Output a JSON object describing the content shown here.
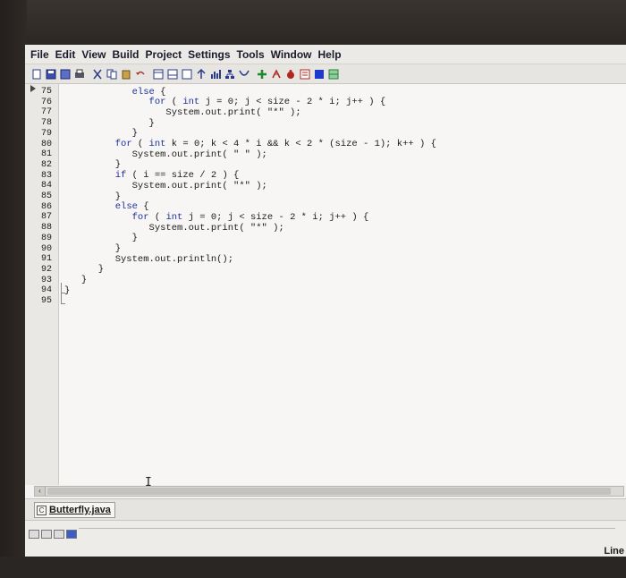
{
  "menu": [
    "File",
    "Edit",
    "View",
    "Build",
    "Project",
    "Settings",
    "Tools",
    "Window",
    "Help"
  ],
  "toolbar_icons": [
    "new-file-icon",
    "save-icon",
    "save-all-icon",
    "print-icon",
    "cut-icon",
    "copy-icon",
    "paste-icon",
    "undo-icon",
    "new-class-icon",
    "new-method-icon",
    "new-field-icon",
    "compile-icon",
    "statistics-icon",
    "uml-icon",
    "run-icon",
    "add-icon",
    "debug-icon",
    "bug-icon",
    "dictionary-icon",
    "stop-icon",
    "layout-icon"
  ],
  "editor": {
    "lines": [
      {
        "num": "75",
        "text": "            else {"
      },
      {
        "num": "76",
        "text": "               for ( int j = 0; j < size - 2 * i; j++ ) {"
      },
      {
        "num": "77",
        "text": "                  System.out.print( \"*\" );"
      },
      {
        "num": "78",
        "text": "               }"
      },
      {
        "num": "79",
        "text": "            }"
      },
      {
        "num": "80",
        "text": "         for ( int k = 0; k < 4 * i && k < 2 * (size - 1); k++ ) {"
      },
      {
        "num": "81",
        "text": "            System.out.print( \" \" );"
      },
      {
        "num": "82",
        "text": "         }"
      },
      {
        "num": "83",
        "text": "         if ( i == size / 2 ) {"
      },
      {
        "num": "84",
        "text": "            System.out.print( \"*\" );"
      },
      {
        "num": "85",
        "text": "         }"
      },
      {
        "num": "86",
        "text": "         else {"
      },
      {
        "num": "87",
        "text": "            for ( int j = 0; j < size - 2 * i; j++ ) {"
      },
      {
        "num": "88",
        "text": "               System.out.print( \"*\" );"
      },
      {
        "num": "89",
        "text": "            }"
      },
      {
        "num": "90",
        "text": "         }"
      },
      {
        "num": "91",
        "text": "         System.out.println();"
      },
      {
        "num": "92",
        "text": "      }"
      },
      {
        "num": "93",
        "text": "   }"
      },
      {
        "num": "94",
        "text": "}"
      },
      {
        "num": "95",
        "text": ""
      }
    ]
  },
  "file_tab": {
    "label": "Butterfly.java",
    "icon": "java-file-icon"
  },
  "status": {
    "text": "Line"
  },
  "colors": {
    "keyword": "#1d2e9c",
    "background": "#f7f6f4"
  }
}
